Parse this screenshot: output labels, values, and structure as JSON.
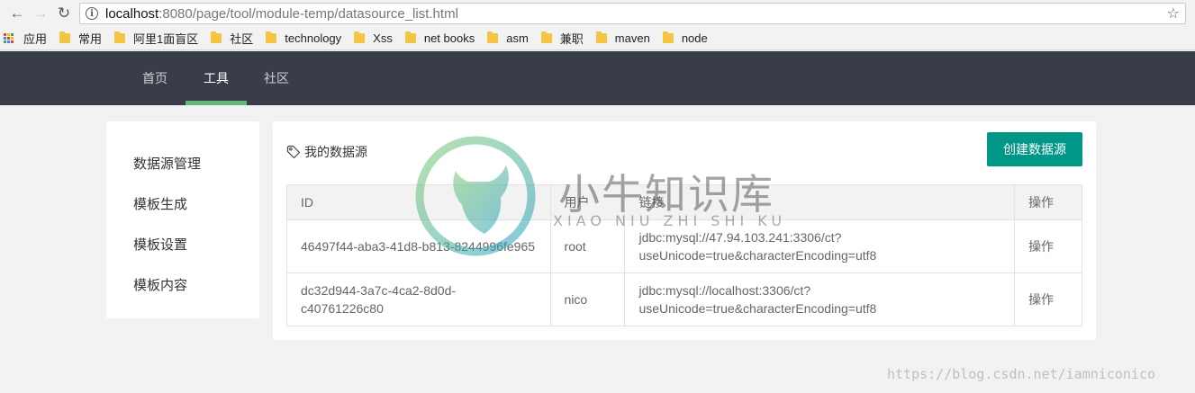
{
  "browser": {
    "url_host": "localhost",
    "url_rest": ":8080/page/tool/module-temp/datasource_list.html",
    "bookmarks": [
      {
        "label": "应用",
        "icon": "apps-icon"
      },
      {
        "label": "常用",
        "icon": "folder-icon"
      },
      {
        "label": "阿里1面盲区",
        "icon": "folder-icon"
      },
      {
        "label": "社区",
        "icon": "folder-icon"
      },
      {
        "label": "technology",
        "icon": "folder-icon"
      },
      {
        "label": "Xss",
        "icon": "folder-icon"
      },
      {
        "label": "net books",
        "icon": "folder-icon"
      },
      {
        "label": "asm",
        "icon": "folder-icon"
      },
      {
        "label": "兼职",
        "icon": "folder-icon"
      },
      {
        "label": "maven",
        "icon": "folder-icon"
      },
      {
        "label": "node",
        "icon": "folder-icon"
      }
    ]
  },
  "topnav": {
    "items": [
      "首页",
      "工具",
      "社区"
    ],
    "active_index": 1,
    "bg_color": "#393d49",
    "active_bar_color": "#5fb878"
  },
  "sidebar": {
    "items": [
      "数据源管理",
      "模板生成",
      "模板设置",
      "模板内容"
    ]
  },
  "main": {
    "title": "我的数据源",
    "create_button": "创建数据源",
    "button_color": "#009688",
    "table": {
      "headers": [
        "ID",
        "用户",
        "链接",
        "操作"
      ],
      "rows": [
        {
          "id": "46497f44-aba3-41d8-b813-8244996fe965",
          "user": "root",
          "link_1": "jdbc:mysql://47.94.103.241:3306/ct?",
          "link_2": "useUnicode=true&characterEncoding=utf8",
          "action": "操作"
        },
        {
          "id_1": "dc32d944-3a7c-4ca2-8d0d-",
          "id_2": "c40761226c80",
          "user": "nico",
          "link_1": "jdbc:mysql://localhost:3306/ct?",
          "link_2": "useUnicode=true&characterEncoding=utf8",
          "action": "操作"
        }
      ]
    }
  },
  "watermark": {
    "title": "小牛知识库",
    "subtitle": "XIAO NIU ZHI SHI KU",
    "corner": "https://blog.csdn.net/iamniconico"
  }
}
